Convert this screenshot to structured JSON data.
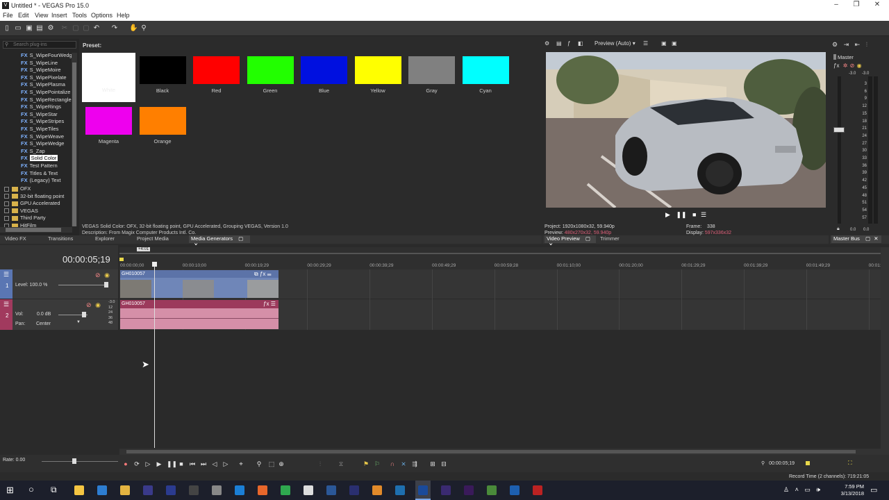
{
  "window": {
    "title": "Untitled * - VEGAS Pro 15.0",
    "logo": "V",
    "minimize": "–",
    "maximize": "❐",
    "close": "✕"
  },
  "menu": [
    "File",
    "Edit",
    "View",
    "Insert",
    "Tools",
    "Options",
    "Help"
  ],
  "plugins": {
    "search_placeholder": "Search plug-ins",
    "fx_items": [
      "S_WipeFourWedg",
      "S_WipeLine",
      "S_WipeMoire",
      "S_WipePixelate",
      "S_WipePlasma",
      "S_WipePointalize",
      "S_WipeRectangle",
      "S_WipeRings",
      "S_WipeStar",
      "S_WipeStripes",
      "S_WipeTiles",
      "S_WipeWeave",
      "S_WipeWedge",
      "S_Zap",
      "Solid Color",
      "Test Pattern",
      "Titles & Text",
      "(Legacy) Text"
    ],
    "fx_badge": "FX",
    "selected": "Solid Color",
    "folders": [
      "OFX",
      "32-bit floating point",
      "GPU Accelerated",
      "VEGAS",
      "Third Party",
      "HitFilm"
    ]
  },
  "presets": {
    "label": "Preset:",
    "items": [
      {
        "name": "White",
        "color": "#ffffff"
      },
      {
        "name": "Black",
        "color": "#000000"
      },
      {
        "name": "Red",
        "color": "#ff0000"
      },
      {
        "name": "Green",
        "color": "#22ff00"
      },
      {
        "name": "Blue",
        "color": "#0010e0"
      },
      {
        "name": "Yellow",
        "color": "#ffff00"
      },
      {
        "name": "Gray",
        "color": "#808080"
      },
      {
        "name": "Cyan",
        "color": "#00ffff"
      },
      {
        "name": "Magenta",
        "color": "#ee00ee"
      },
      {
        "name": "Orange",
        "color": "#ff7f00"
      }
    ],
    "desc1": "VEGAS Solid Color: OFX, 32-bit floating point, GPU Accelerated, Grouping VEGAS, Version 1.0",
    "desc2": "Description: From Magix Computer Products Intl. Co."
  },
  "bottom_tabs": [
    "Video FX",
    "Transitions",
    "Explorer",
    "Project Media",
    "Media Generators"
  ],
  "preview": {
    "mode": "Preview (Auto)",
    "project_label": "Project:",
    "project_value": "1920x1080x32, 59.940p",
    "preview_label": "Preview:",
    "preview_value": "480x270x32, 59.940p",
    "frame_label": "Frame:",
    "frame_value": "338",
    "display_label": "Display:",
    "display_value": "597x336x32",
    "tabs": [
      "Video Preview",
      "Trimmer"
    ]
  },
  "master": {
    "title": "Master",
    "peak_l": "-3.0",
    "peak_r": "-3.0",
    "scale": [
      "3",
      "6",
      "9",
      "12",
      "15",
      "18",
      "21",
      "24",
      "27",
      "30",
      "33",
      "36",
      "39",
      "42",
      "45",
      "48",
      "51",
      "54",
      "57"
    ],
    "bottom_l": "0.0",
    "bottom_r": "0.0",
    "tab": "Master Bus"
  },
  "timeline": {
    "timecode": "00:00:05;19",
    "ruler": [
      "00:00:00;00",
      "00:00:10;00",
      "00:00:19;29",
      "00:00:29;29",
      "00:00:39;29",
      "00:00:49;29",
      "00:00:59;28",
      "00:01:10;00",
      "00:01:20;00",
      "00:01:29;29",
      "00:01:39;29",
      "00:01:49;29",
      "00:01:59"
    ],
    "marker": "+4:01",
    "video_track": {
      "level_label": "Level: 100.0 %",
      "clip": "GH010057"
    },
    "audio_track": {
      "vol_label": "Vol:",
      "vol_value": "0.0 dB",
      "pan_label": "Pan:",
      "pan_value": "Center",
      "clip": "GH010057",
      "db_marks": [
        "-3.0",
        "12",
        "24",
        "36",
        "48"
      ]
    },
    "rate": "Rate: 0.00",
    "cursor_time": "00:00:05;19",
    "record_time": "Record Time (2 channels): 719:21:05"
  },
  "taskbar": {
    "time": "7:59 PM",
    "date": "3/13/2018",
    "apps": [
      "file-explorer",
      "store",
      "folder",
      "obs",
      "photoshop",
      "media-player",
      "davinci",
      "edge",
      "firefox",
      "chrome",
      "mail",
      "word",
      "audition",
      "vlc",
      "vegas-old",
      "vegas",
      "after-effects",
      "premiere",
      "green-app",
      "blue-app",
      "red-app"
    ],
    "app_colors": [
      "#f5c542",
      "#2d7dd2",
      "#e3b341",
      "#3a3a8a",
      "#2b3b8f",
      "#444",
      "#888",
      "#1b7fd6",
      "#e8672b",
      "#2fa84f",
      "#ddd",
      "#2b5797",
      "#2a2f70",
      "#e28a2a",
      "#1e6fb0",
      "#1a4a9a",
      "#3a2a70",
      "#3a1a5a",
      "#4a8a3a",
      "#1d5fb0",
      "#b22"
    ]
  }
}
